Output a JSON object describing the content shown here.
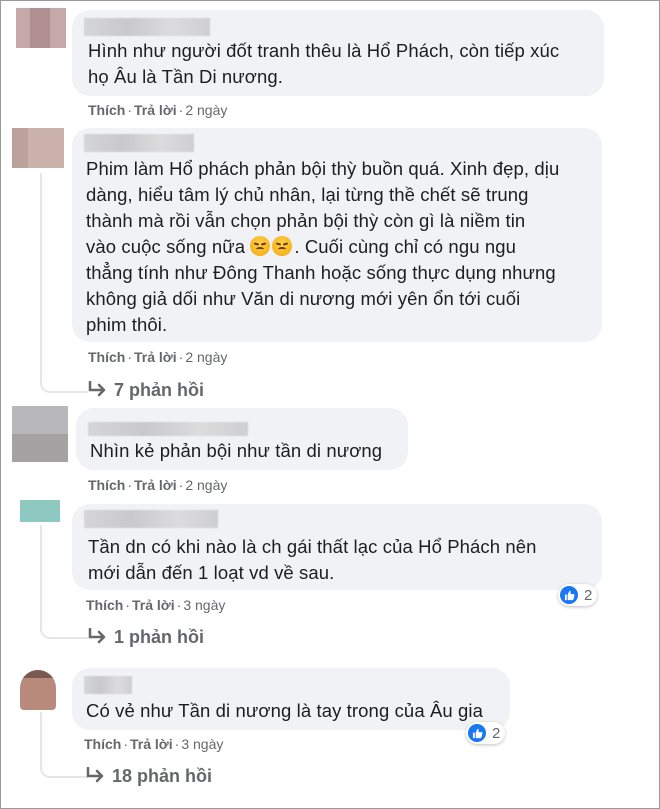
{
  "comments": [
    {
      "text": "Hình như người đốt tranh thêu là Hổ Phách, còn tiếp xúc\nhọ Âu là Tần Di nương.",
      "like": "Thích",
      "reply": "Trả lời",
      "time": "2 ngày"
    },
    {
      "text_before_emoji": "Phim làm Hổ phách phản bội thỳ buồn quá. Xinh đẹp, dịu\ndàng, hiểu tâm lý chủ nhân, lại từng thề chết sẽ trung\nthành mà rồi vẫn chọn phản bội thỳ còn gì là niềm tin\nvào cuộc sống nữa ",
      "text_after_emoji": ". Cuối cùng chỉ có ngu ngu\nthẳng tính như Đông Thanh hoặc sống thực dụng nhưng\nkhông giả dối như Văn di nương mới yên ổn tới cuối\nphim thôi.",
      "emojis": [
        "weary-face",
        "weary-face"
      ],
      "like": "Thích",
      "reply": "Trả lời",
      "time": "2 ngày",
      "replies": "7 phản hồi"
    },
    {
      "text": "Nhìn kẻ phản bội như tần di nương",
      "like": "Thích",
      "reply": "Trả lời",
      "time": "2 ngày"
    },
    {
      "text": "Tần dn có khi nào là ch gái thất lạc của Hổ Phách nên\nmới dẫn đến 1 loạt vd về sau.",
      "like": "Thích",
      "reply": "Trả lời",
      "time": "3 ngày",
      "reaction_count": "2",
      "reaction_icon": "like-icon",
      "replies": "1 phản hồi"
    },
    {
      "text": "Có vẻ như Tần di nương là tay trong của Âu gia",
      "like": "Thích",
      "reply": "Trả lời",
      "time": "3 ngày",
      "reaction_count": "2",
      "reaction_icon": "like-icon",
      "replies": "18 phản hồi"
    }
  ],
  "colors": {
    "bubble": "#f0f2f5",
    "meta": "#65676b",
    "text": "#1c1e21",
    "like_blue": "#1877f2"
  }
}
